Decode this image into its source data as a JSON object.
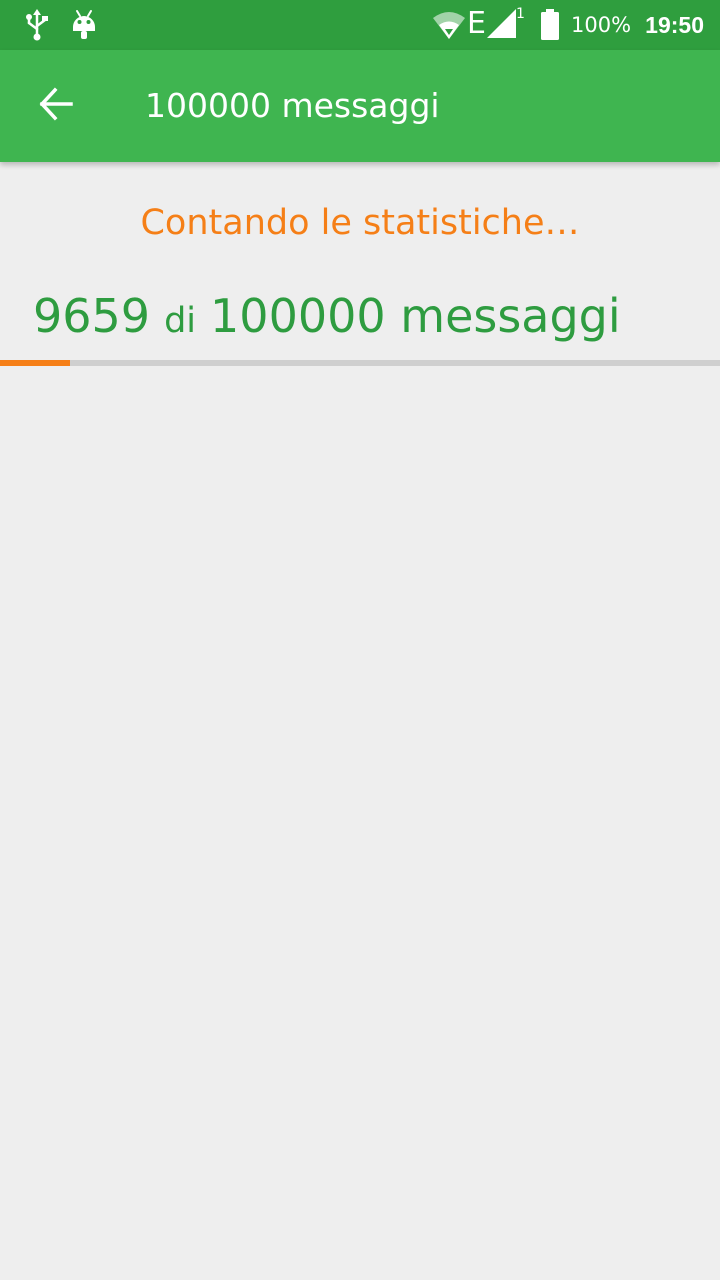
{
  "status_bar": {
    "network_type": "E",
    "sim_number": "1",
    "battery_percent": "100%",
    "time": "19:50",
    "icons": [
      "usb-icon",
      "android-icon",
      "wifi-icon",
      "signal-icon",
      "battery-icon"
    ]
  },
  "app_bar": {
    "title": "100000 messaggi",
    "back_icon": "arrow-back-icon"
  },
  "content": {
    "status_text": "Contando le statistiche…",
    "current": "9659",
    "separator": "di",
    "total_label": "100000 messaggi",
    "progress": 0.0966
  },
  "colors": {
    "status_bar": "#2f9e3e",
    "app_bar": "#3fb550",
    "accent_orange": "#f57f17",
    "text_green": "#2e9c40",
    "background": "#eeeeee",
    "track": "#cfcfcf"
  }
}
